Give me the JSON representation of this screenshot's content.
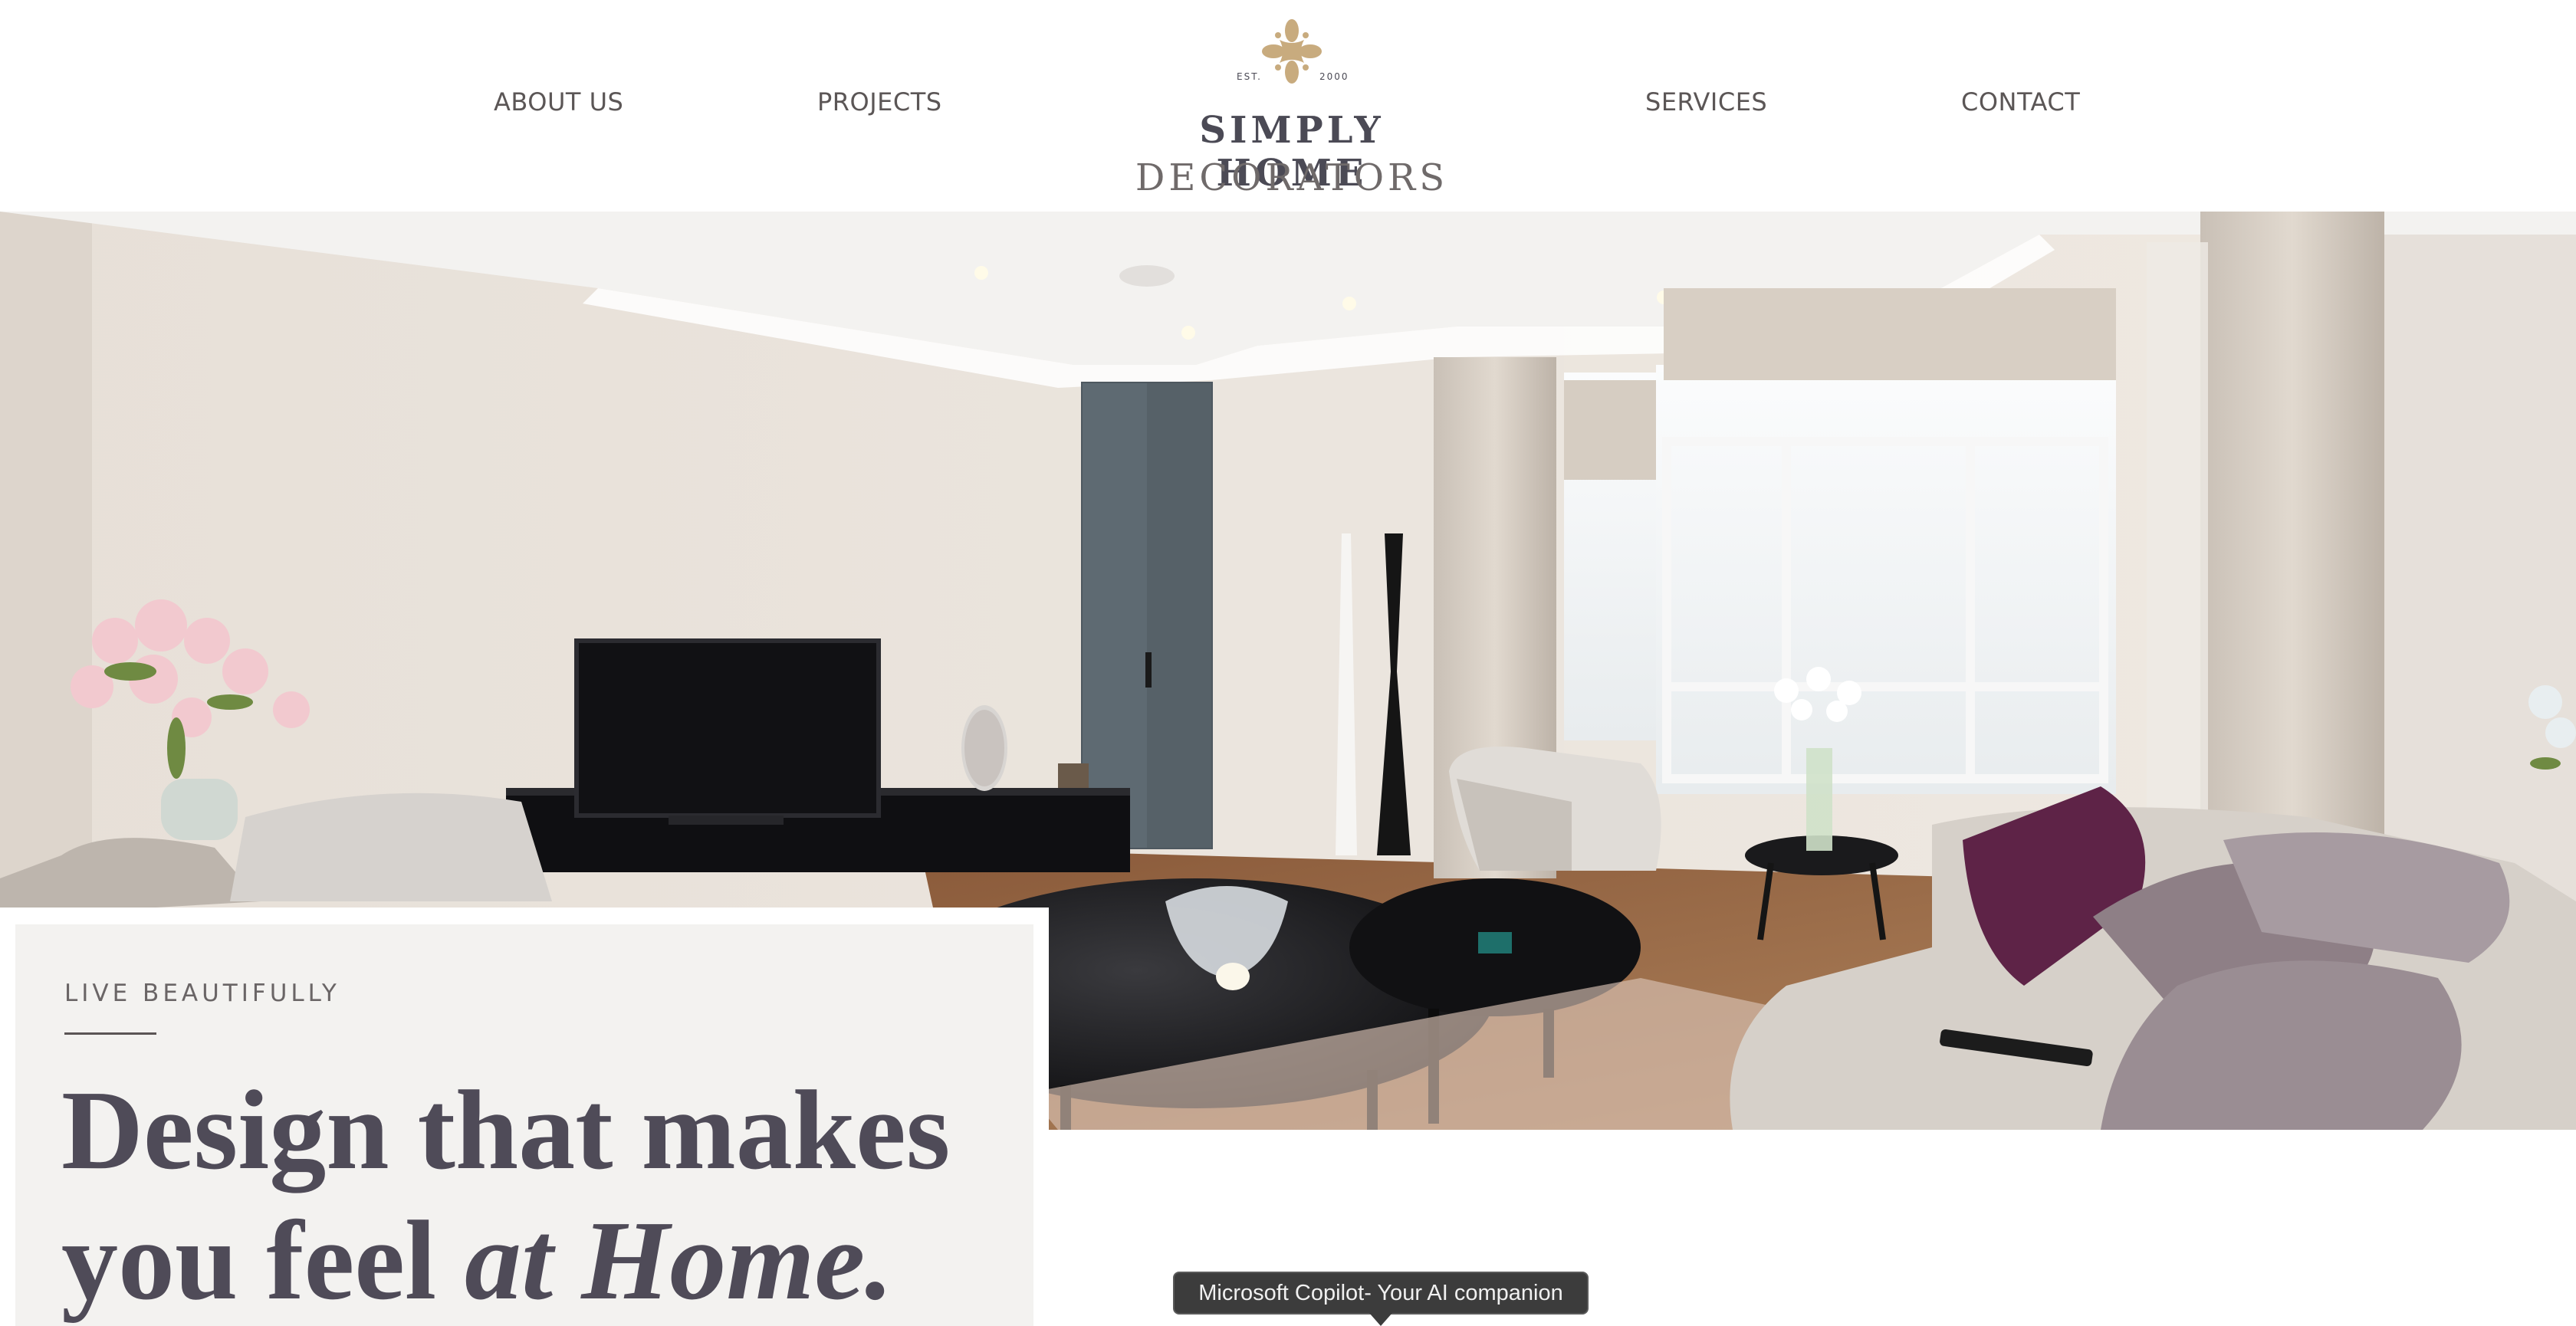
{
  "nav": {
    "about_label": "ABOUT US",
    "projects_label": "PROJECTS",
    "services_label": "SERVICES",
    "contact_label": "CONTACT"
  },
  "brand": {
    "est_label": "EST.",
    "year": "2000",
    "line1": "SIMPLY HOME",
    "line2": "DECORATORS",
    "mark_icon": "fleur-ornament-icon",
    "gold": "#c8ab7e"
  },
  "hero": {
    "image_subject": "living room interior photo"
  },
  "card": {
    "eyebrow": "LIVE BEAUTIFULLY",
    "headline_line1": "Design that makes",
    "headline_line2_plain": "you feel ",
    "headline_line2_italic": "at Home."
  },
  "tooltip": {
    "text": "Microsoft Copilot- Your AI companion"
  },
  "colors": {
    "text_dark": "#4f4b58",
    "nav_text": "#5b5656",
    "card_bg": "#f3f2f0",
    "accent_plum": "#5e2347"
  }
}
